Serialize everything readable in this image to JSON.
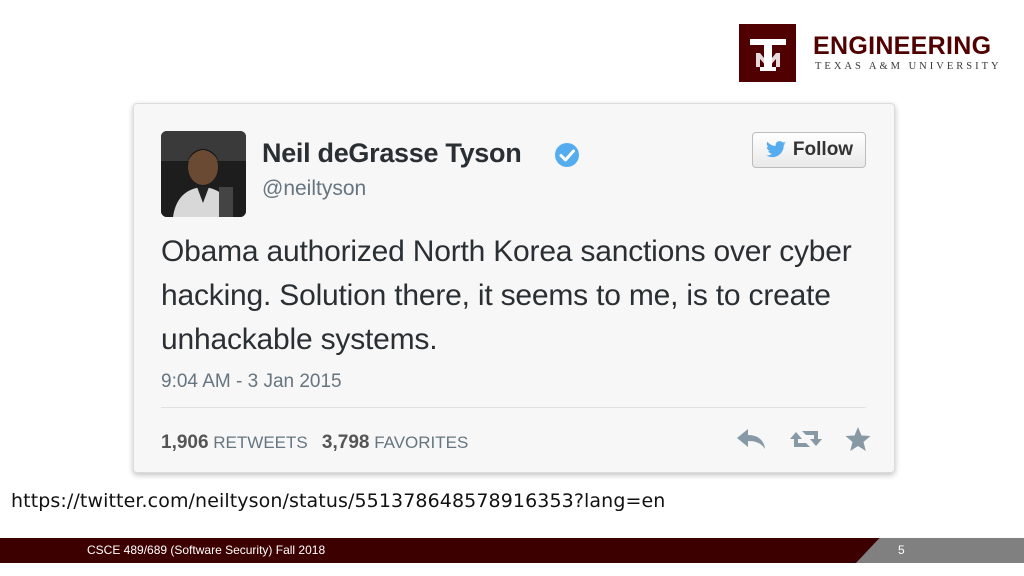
{
  "logo": {
    "monogram": "ATM",
    "title": "ENGINEERING",
    "subtitle": "TEXAS A&M UNIVERSITY"
  },
  "tweet": {
    "author_name": "Neil deGrasse Tyson",
    "handle": "@neiltyson",
    "follow_label": "Follow",
    "text": "Obama authorized North Korea sanctions over cyber hacking.  Solution there, it seems to me, is to create unhackable systems.",
    "timestamp": "9:04 AM - 3 Jan 2015",
    "retweets_count": "1,906",
    "retweets_label": "RETWEETS",
    "favorites_count": "3,798",
    "favorites_label": "FAVORITES",
    "icons": [
      "verified-icon",
      "twitter-bird-icon",
      "reply-icon",
      "retweet-icon",
      "favorite-star-icon"
    ],
    "colors": {
      "twitter_blue": "#55acee",
      "text": "#292f33",
      "muted": "#66757f"
    }
  },
  "source_url": "https://twitter.com/neiltyson/status/551378648578916353?lang=en",
  "footer": {
    "course": "CSCE 489/689 (Software Security) Fall 2018",
    "page_number": "5",
    "colors": {
      "maroon": "#3d0000",
      "gray": "#808080"
    }
  }
}
